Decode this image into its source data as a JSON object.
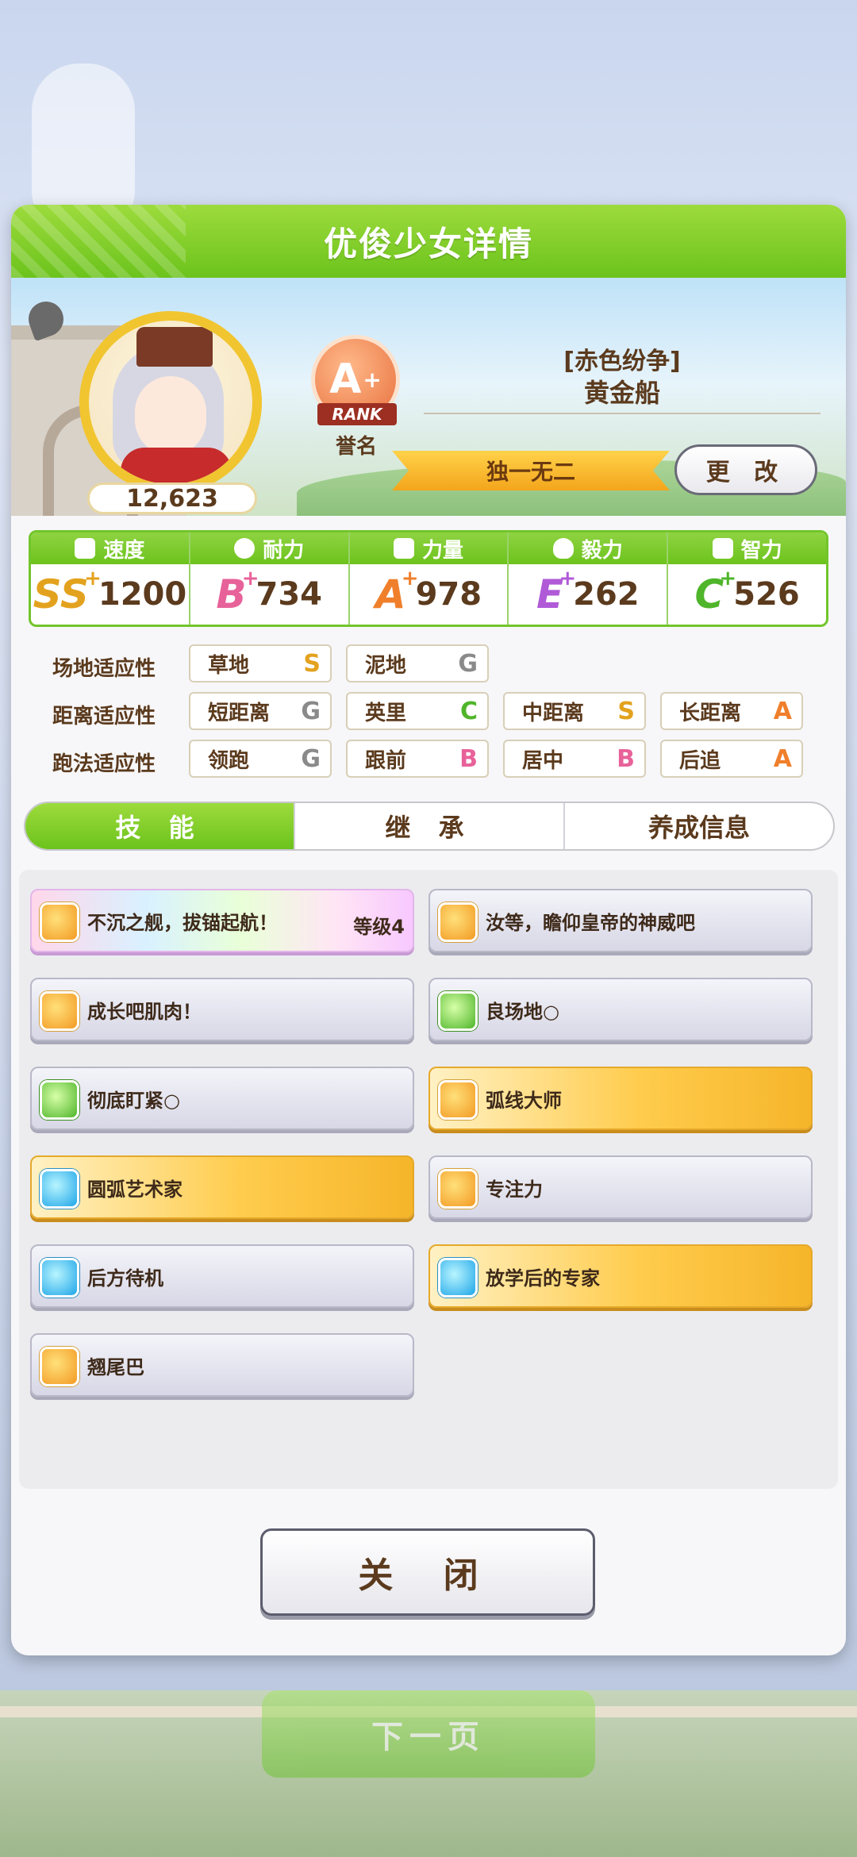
{
  "background": {
    "next_button": "下一页"
  },
  "dialog": {
    "title": "优俊少女详情"
  },
  "profile": {
    "score": "12,623",
    "rank_grade": "A",
    "rank_plus": "+",
    "rank_ribbon": "RANK",
    "rank_label": "誉名",
    "epithet": "[赤色纷争]",
    "name": "黄金船",
    "title": "独一无二",
    "change_button": "更 改"
  },
  "stats": [
    {
      "label": "速度",
      "grade": "SS",
      "plus": "+",
      "value": "1200",
      "color": "#e3a21e",
      "icon": "shoe-icon"
    },
    {
      "label": "耐力",
      "grade": "B",
      "plus": "+",
      "value": "734",
      "color": "#e8629a",
      "icon": "heart-icon"
    },
    {
      "label": "力量",
      "grade": "A",
      "plus": "+",
      "value": "978",
      "color": "#f07f2b",
      "icon": "muscle-icon"
    },
    {
      "label": "毅力",
      "grade": "E",
      "plus": "+",
      "value": "262",
      "color": "#b05ad8",
      "icon": "flame-icon"
    },
    {
      "label": "智力",
      "grade": "C",
      "plus": "+",
      "value": "526",
      "color": "#6cc31c",
      "icon": "graduation-cap-icon"
    }
  ],
  "aptitude": {
    "track_label": "场地适应性",
    "track": [
      {
        "name": "草地",
        "grade": "S"
      },
      {
        "name": "泥地",
        "grade": "G"
      }
    ],
    "distance_label": "距离适应性",
    "distance": [
      {
        "name": "短距离",
        "grade": "G"
      },
      {
        "name": "英里",
        "grade": "C"
      },
      {
        "name": "中距离",
        "grade": "S"
      },
      {
        "name": "长距离",
        "grade": "A"
      }
    ],
    "style_label": "跑法适应性",
    "style": [
      {
        "name": "领跑",
        "grade": "G"
      },
      {
        "name": "跟前",
        "grade": "B"
      },
      {
        "name": "居中",
        "grade": "B"
      },
      {
        "name": "后追",
        "grade": "A"
      }
    ]
  },
  "grade_colors": {
    "S": "#e3a21e",
    "A": "#f07f2b",
    "B": "#e8629a",
    "C": "#4fb52a",
    "G": "#8a8a8a"
  },
  "tabs": [
    {
      "label": "技 能"
    },
    {
      "label": "继 承"
    },
    {
      "label": "养成信息"
    }
  ],
  "skills": [
    {
      "name": "不沉之舰，拔锚起航！",
      "level": "等级4",
      "style": "rainbow",
      "icon": "horse-rider-icon"
    },
    {
      "name": "汝等，瞻仰皇帝的神威吧",
      "style": "plain",
      "icon": "horse-rider-icon"
    },
    {
      "name": "成长吧肌肉！",
      "style": "plain",
      "icon": "horse-rider-icon"
    },
    {
      "name": "良场地○",
      "style": "plain",
      "icon": "muscle-icon"
    },
    {
      "name": "彻底盯紧○",
      "style": "plain",
      "icon": "flame-icon"
    },
    {
      "name": "弧线大师",
      "style": "gold",
      "icon": "horse-rider-icon"
    },
    {
      "name": "圆弧艺术家",
      "style": "gold",
      "icon": "sparkle-icon"
    },
    {
      "name": "专注力",
      "style": "plain",
      "icon": "gate-icon"
    },
    {
      "name": "后方待机",
      "style": "plain",
      "icon": "sparkle-icon"
    },
    {
      "name": "放学后的专家",
      "style": "gold",
      "icon": "sparkle-icon"
    },
    {
      "name": "翘尾巴",
      "style": "plain",
      "icon": "horse-rider-icon"
    }
  ],
  "close_button": "关 闭"
}
